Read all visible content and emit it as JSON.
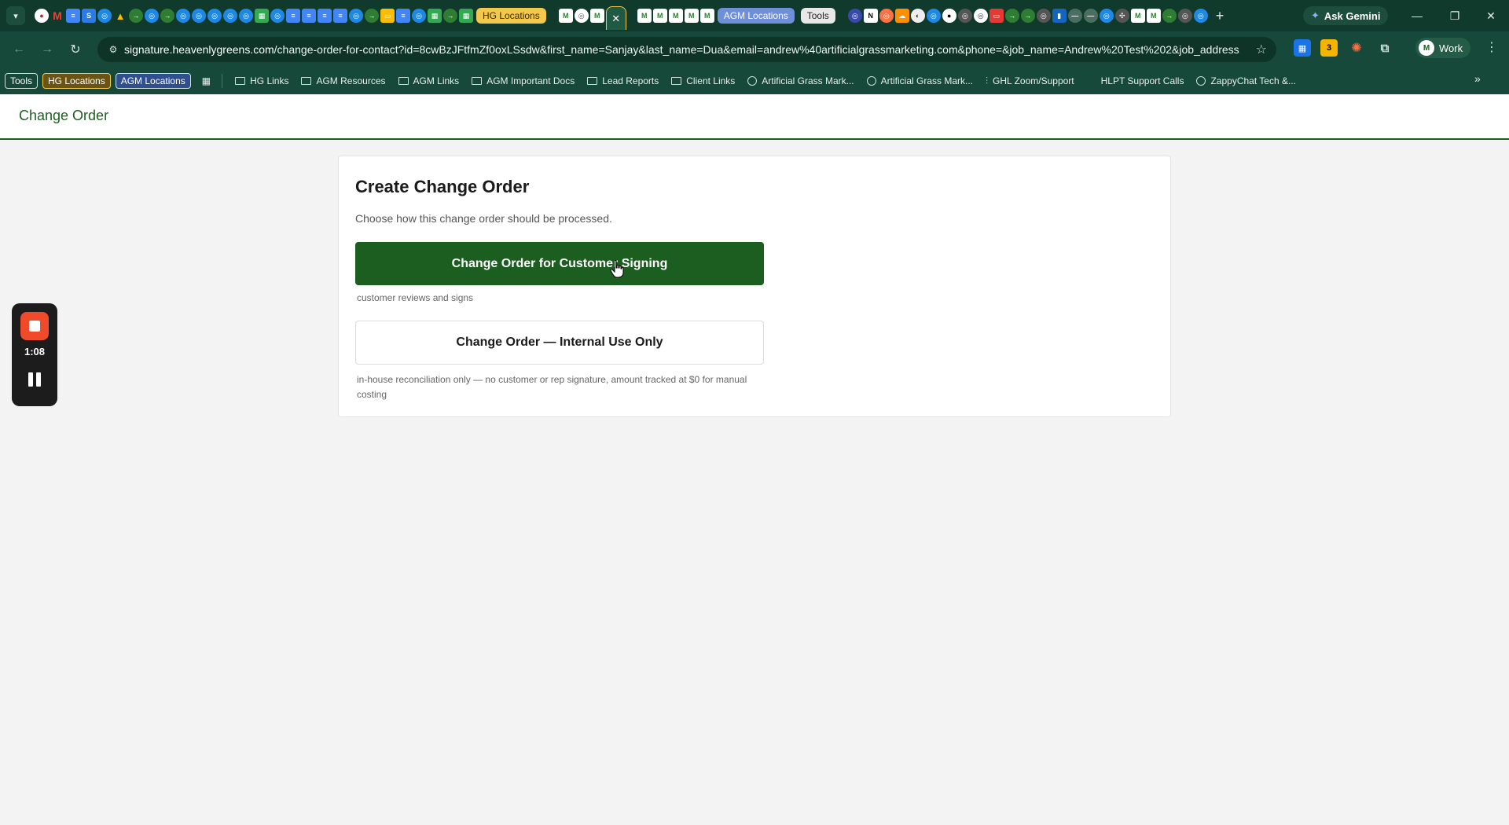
{
  "browser": {
    "tab_groups": {
      "hg": "HG Locations",
      "agm": "AGM Locations",
      "tools": "Tools"
    },
    "ask_gemini": "Ask Gemini",
    "url_domain": "signature.heavenlygreens.com",
    "url_path": "/change-order-for-contact?id=8cwBzJFtfmZf0oxLSsdw&first_name=Sanjay&last_name=Dua&email=andrew%40artificialgrassmarketing.com&phone=&job_name=Andrew%20Test%202&job_address...",
    "profile": "Work",
    "extension_badge": "3",
    "accent_color": "#1b5e20"
  },
  "bookmarks": {
    "chips": [
      "Tools",
      "HG Locations",
      "AGM Locations"
    ],
    "items": [
      {
        "label": "HG Links",
        "icon": "folder-icon"
      },
      {
        "label": "AGM Resources",
        "icon": "folder-icon"
      },
      {
        "label": "AGM Links",
        "icon": "folder-icon"
      },
      {
        "label": "AGM Important Docs",
        "icon": "folder-icon"
      },
      {
        "label": "Lead Reports",
        "icon": "folder-icon"
      },
      {
        "label": "Client Links",
        "icon": "folder-icon"
      },
      {
        "label": "Artificial Grass Mark...",
        "icon": "globe-icon"
      },
      {
        "label": "Artificial Grass Mark...",
        "icon": "globe-icon"
      },
      {
        "label": "GHL Zoom/Support",
        "icon": "chart-icon"
      },
      {
        "label": "HLPT Support Calls",
        "icon": "none"
      },
      {
        "label": "ZappyChat Tech &...",
        "icon": "globe-icon"
      }
    ]
  },
  "page": {
    "header_title": "Change Order",
    "card_title": "Create Change Order",
    "card_subtitle": "Choose how this change order should be processed.",
    "primary_button": "Change Order for Customer Signing",
    "primary_hint": "customer reviews and signs",
    "secondary_button": "Change Order — Internal Use Only",
    "secondary_hint": "in-house reconciliation only — no customer or rep signature, amount tracked at $0 for manual costing"
  },
  "recorder": {
    "elapsed": "1:08"
  }
}
